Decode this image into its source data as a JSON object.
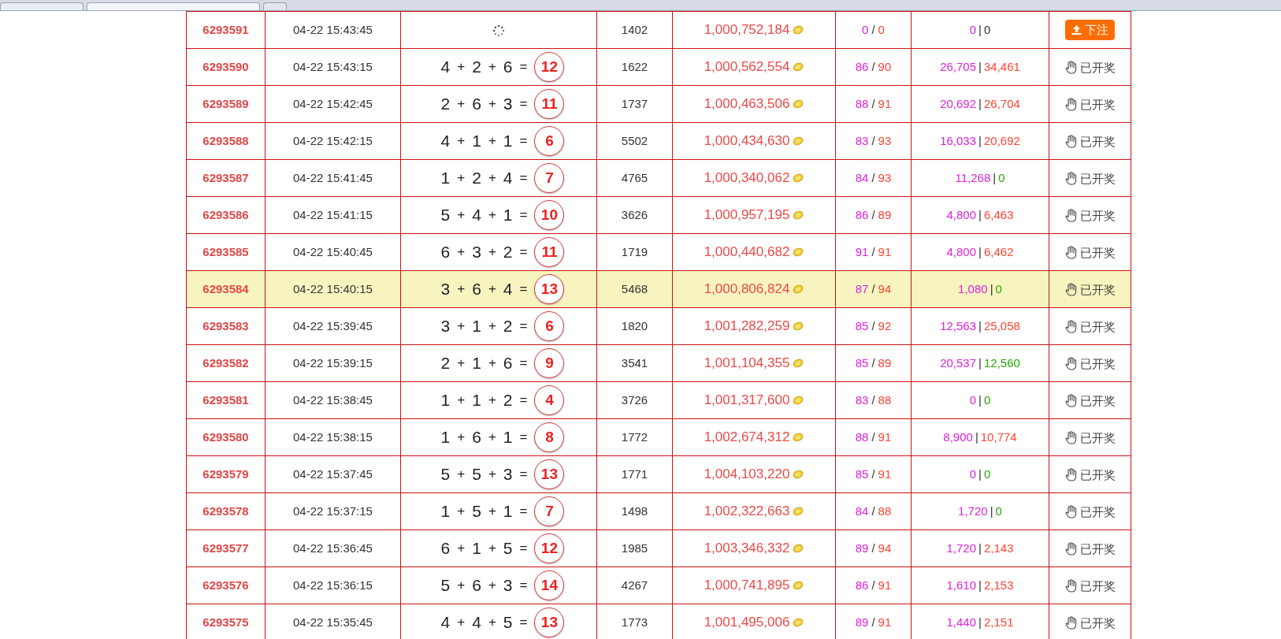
{
  "rows": [
    {
      "kind": "pending",
      "selected": false,
      "issue": "6293591",
      "time": "04-22 15:43:45",
      "players": "1402",
      "pool": "1,000,752,184",
      "ratio": [
        "0",
        "/",
        "0"
      ],
      "bets": [
        {
          "text": "0",
          "color": "#dd22dd"
        },
        {
          "text": "|"
        },
        {
          "text": "0",
          "color": "#333333"
        }
      ],
      "action": "下注"
    },
    {
      "kind": "drawn",
      "selected": false,
      "issue": "6293590",
      "time": "04-22 15:43:15",
      "equation": [
        "4",
        "+",
        "2",
        "+",
        "6",
        "="
      ],
      "sum": "12",
      "players": "1622",
      "pool": "1,000,562,554",
      "ratio": [
        "86",
        "/",
        "90"
      ],
      "bets": [
        {
          "text": "26,705",
          "color": "#dd22dd"
        },
        {
          "text": "|"
        },
        {
          "text": "34,461",
          "color": "#ff4433"
        }
      ],
      "action": "已开奖"
    },
    {
      "kind": "drawn",
      "selected": false,
      "issue": "6293589",
      "time": "04-22 15:42:45",
      "equation": [
        "2",
        "+",
        "6",
        "+",
        "3",
        "="
      ],
      "sum": "11",
      "players": "1737",
      "pool": "1,000,463,506",
      "ratio": [
        "88",
        "/",
        "91"
      ],
      "bets": [
        {
          "text": "20,692",
          "color": "#dd22dd"
        },
        {
          "text": "|"
        },
        {
          "text": "26,704",
          "color": "#ff4433"
        }
      ],
      "action": "已开奖"
    },
    {
      "kind": "drawn",
      "selected": false,
      "issue": "6293588",
      "time": "04-22 15:42:15",
      "equation": [
        "4",
        "+",
        "1",
        "+",
        "1",
        "="
      ],
      "sum": "6",
      "players": "5502",
      "pool": "1,000,434,630",
      "ratio": [
        "83",
        "/",
        "93"
      ],
      "bets": [
        {
          "text": "16,033",
          "color": "#dd22dd"
        },
        {
          "text": "|"
        },
        {
          "text": "20,692",
          "color": "#ff4433"
        }
      ],
      "action": "已开奖"
    },
    {
      "kind": "drawn",
      "selected": false,
      "issue": "6293587",
      "time": "04-22 15:41:45",
      "equation": [
        "1",
        "+",
        "2",
        "+",
        "4",
        "="
      ],
      "sum": "7",
      "players": "4765",
      "pool": "1,000,340,062",
      "ratio": [
        "84",
        "/",
        "93"
      ],
      "bets": [
        {
          "text": "11,268",
          "color": "#dd22dd"
        },
        {
          "text": "|"
        },
        {
          "text": "0",
          "color": "#22aa00"
        }
      ],
      "action": "已开奖"
    },
    {
      "kind": "drawn",
      "selected": false,
      "issue": "6293586",
      "time": "04-22 15:41:15",
      "equation": [
        "5",
        "+",
        "4",
        "+",
        "1",
        "="
      ],
      "sum": "10",
      "players": "3626",
      "pool": "1,000,957,195",
      "ratio": [
        "86",
        "/",
        "89"
      ],
      "bets": [
        {
          "text": "4,800",
          "color": "#dd22dd"
        },
        {
          "text": "|"
        },
        {
          "text": "6,463",
          "color": "#ff4433"
        }
      ],
      "action": "已开奖"
    },
    {
      "kind": "drawn",
      "selected": false,
      "issue": "6293585",
      "time": "04-22 15:40:45",
      "equation": [
        "6",
        "+",
        "3",
        "+",
        "2",
        "="
      ],
      "sum": "11",
      "players": "1719",
      "pool": "1,000,440,682",
      "ratio": [
        "91",
        "/",
        "91"
      ],
      "bets": [
        {
          "text": "4,800",
          "color": "#dd22dd"
        },
        {
          "text": "|"
        },
        {
          "text": "6,462",
          "color": "#ff4433"
        }
      ],
      "action": "已开奖"
    },
    {
      "kind": "drawn",
      "selected": true,
      "issue": "6293584",
      "time": "04-22 15:40:15",
      "equation": [
        "3",
        "+",
        "6",
        "+",
        "4",
        "="
      ],
      "sum": "13",
      "players": "5468",
      "pool": "1,000,806,824",
      "ratio": [
        "87",
        "/",
        "94"
      ],
      "bets": [
        {
          "text": "1,080",
          "color": "#dd22dd"
        },
        {
          "text": "|"
        },
        {
          "text": "0",
          "color": "#22aa00"
        }
      ],
      "action": "已开奖"
    },
    {
      "kind": "drawn",
      "selected": false,
      "issue": "6293583",
      "time": "04-22 15:39:45",
      "equation": [
        "3",
        "+",
        "1",
        "+",
        "2",
        "="
      ],
      "sum": "6",
      "players": "1820",
      "pool": "1,001,282,259",
      "ratio": [
        "85",
        "/",
        "92"
      ],
      "bets": [
        {
          "text": "12,563",
          "color": "#dd22dd"
        },
        {
          "text": "|"
        },
        {
          "text": "25,058",
          "color": "#ff4433"
        }
      ],
      "action": "已开奖"
    },
    {
      "kind": "drawn",
      "selected": false,
      "issue": "6293582",
      "time": "04-22 15:39:15",
      "equation": [
        "2",
        "+",
        "1",
        "+",
        "6",
        "="
      ],
      "sum": "9",
      "players": "3541",
      "pool": "1,001,104,355",
      "ratio": [
        "85",
        "/",
        "89"
      ],
      "bets": [
        {
          "text": "20,537",
          "color": "#dd22dd"
        },
        {
          "text": "|"
        },
        {
          "text": "12,560",
          "color": "#22aa00"
        }
      ],
      "action": "已开奖"
    },
    {
      "kind": "drawn",
      "selected": false,
      "issue": "6293581",
      "time": "04-22 15:38:45",
      "equation": [
        "1",
        "+",
        "1",
        "+",
        "2",
        "="
      ],
      "sum": "4",
      "players": "3726",
      "pool": "1,001,317,600",
      "ratio": [
        "83",
        "/",
        "88"
      ],
      "bets": [
        {
          "text": "0",
          "color": "#dd22dd"
        },
        {
          "text": "|"
        },
        {
          "text": "0",
          "color": "#22aa00"
        }
      ],
      "action": "已开奖"
    },
    {
      "kind": "drawn",
      "selected": false,
      "issue": "6293580",
      "time": "04-22 15:38:15",
      "equation": [
        "1",
        "+",
        "6",
        "+",
        "1",
        "="
      ],
      "sum": "8",
      "players": "1772",
      "pool": "1,002,674,312",
      "ratio": [
        "88",
        "/",
        "91"
      ],
      "bets": [
        {
          "text": "8,900",
          "color": "#dd22dd"
        },
        {
          "text": "|"
        },
        {
          "text": "10,774",
          "color": "#ff4433"
        }
      ],
      "action": "已开奖"
    },
    {
      "kind": "drawn",
      "selected": false,
      "issue": "6293579",
      "time": "04-22 15:37:45",
      "equation": [
        "5",
        "+",
        "5",
        "+",
        "3",
        "="
      ],
      "sum": "13",
      "players": "1771",
      "pool": "1,004,103,220",
      "ratio": [
        "85",
        "/",
        "91"
      ],
      "bets": [
        {
          "text": "0",
          "color": "#dd22dd"
        },
        {
          "text": "|"
        },
        {
          "text": "0",
          "color": "#22aa00"
        }
      ],
      "action": "已开奖"
    },
    {
      "kind": "drawn",
      "selected": false,
      "issue": "6293578",
      "time": "04-22 15:37:15",
      "equation": [
        "1",
        "+",
        "5",
        "+",
        "1",
        "="
      ],
      "sum": "7",
      "players": "1498",
      "pool": "1,002,322,663",
      "ratio": [
        "84",
        "/",
        "88"
      ],
      "bets": [
        {
          "text": "1,720",
          "color": "#dd22dd"
        },
        {
          "text": "|"
        },
        {
          "text": "0",
          "color": "#22aa00"
        }
      ],
      "action": "已开奖"
    },
    {
      "kind": "drawn",
      "selected": false,
      "issue": "6293577",
      "time": "04-22 15:36:45",
      "equation": [
        "6",
        "+",
        "1",
        "+",
        "5",
        "="
      ],
      "sum": "12",
      "players": "1985",
      "pool": "1,003,346,332",
      "ratio": [
        "89",
        "/",
        "94"
      ],
      "bets": [
        {
          "text": "1,720",
          "color": "#dd22dd"
        },
        {
          "text": "|"
        },
        {
          "text": "2,143",
          "color": "#ff4433"
        }
      ],
      "action": "已开奖"
    },
    {
      "kind": "drawn",
      "selected": false,
      "issue": "6293576",
      "time": "04-22 15:36:15",
      "equation": [
        "5",
        "+",
        "6",
        "+",
        "3",
        "="
      ],
      "sum": "14",
      "players": "4267",
      "pool": "1,000,741,895",
      "ratio": [
        "86",
        "/",
        "91"
      ],
      "bets": [
        {
          "text": "1,610",
          "color": "#dd22dd"
        },
        {
          "text": "|"
        },
        {
          "text": "2,153",
          "color": "#ff4433"
        }
      ],
      "action": "已开奖"
    },
    {
      "kind": "drawn",
      "selected": false,
      "issue": "6293575",
      "time": "04-22 15:35:45",
      "equation": [
        "4",
        "+",
        "4",
        "+",
        "5",
        "="
      ],
      "sum": "13",
      "players": "1773",
      "pool": "1,001,495,006",
      "ratio": [
        "89",
        "/",
        "91"
      ],
      "bets": [
        {
          "text": "1,440",
          "color": "#dd22dd"
        },
        {
          "text": "|"
        },
        {
          "text": "2,151",
          "color": "#ff4433"
        }
      ],
      "action": "已开奖"
    }
  ]
}
